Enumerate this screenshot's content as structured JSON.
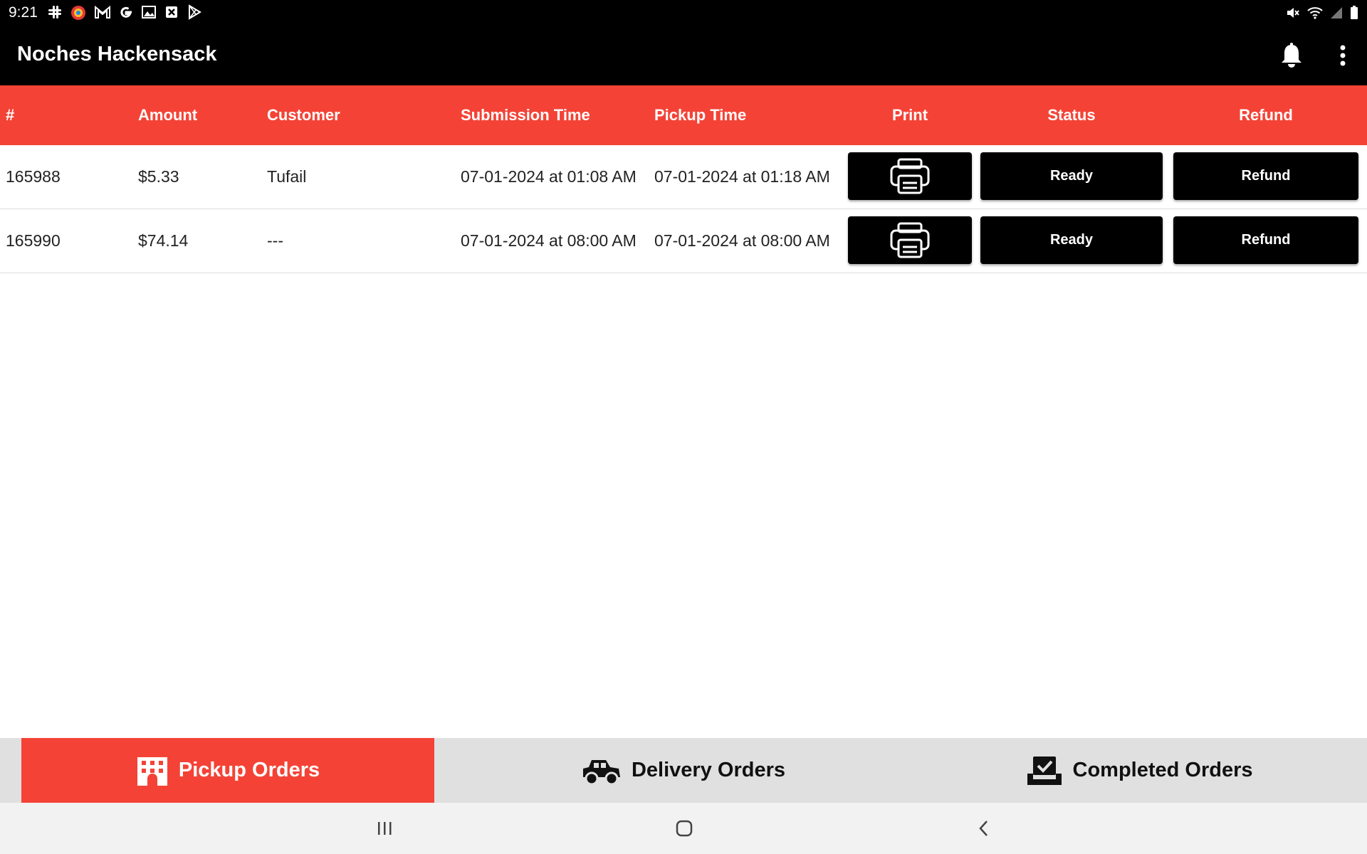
{
  "status_bar": {
    "time": "9:21",
    "left_icons": [
      "slack-icon",
      "app-badge-icon",
      "gmail-icon",
      "google-icon",
      "gallery-icon",
      "close-box-icon",
      "play-store-icon"
    ],
    "right_icons": [
      "mute-icon",
      "wifi-icon",
      "signal-icon",
      "battery-icon"
    ]
  },
  "app_bar": {
    "title": "Noches Hackensack",
    "icons": [
      "bell-icon",
      "more-vertical-icon"
    ]
  },
  "table": {
    "headers": {
      "number": "#",
      "amount": "Amount",
      "customer": "Customer",
      "submission_time": "Submission Time",
      "pickup_time": "Pickup Time",
      "print": "Print",
      "status": "Status",
      "refund": "Refund"
    },
    "rows": [
      {
        "number": "165988",
        "amount": "$5.33",
        "customer": "Tufail",
        "submission_time": "07-01-2024 at 01:08 AM",
        "pickup_time": "07-01-2024 at 01:18 AM",
        "status_label": "Ready",
        "refund_label": "Refund"
      },
      {
        "number": "165990",
        "amount": "$74.14",
        "customer": "---",
        "submission_time": "07-01-2024 at 08:00 AM",
        "pickup_time": "07-01-2024 at 08:00 AM",
        "status_label": "Ready",
        "refund_label": "Refund"
      }
    ]
  },
  "bottom_tabs": [
    {
      "label": "Pickup Orders",
      "icon": "building-icon",
      "active": true
    },
    {
      "label": "Delivery Orders",
      "icon": "truck-icon",
      "active": false
    },
    {
      "label": "Completed Orders",
      "icon": "inbox-check-icon",
      "active": false
    }
  ],
  "nav_bar": [
    "recent-apps-icon",
    "home-icon",
    "back-icon"
  ],
  "colors": {
    "accent": "#f44336",
    "app_bar": "#000000",
    "button": "#000000",
    "tab_bar": "#e0e0e0"
  }
}
